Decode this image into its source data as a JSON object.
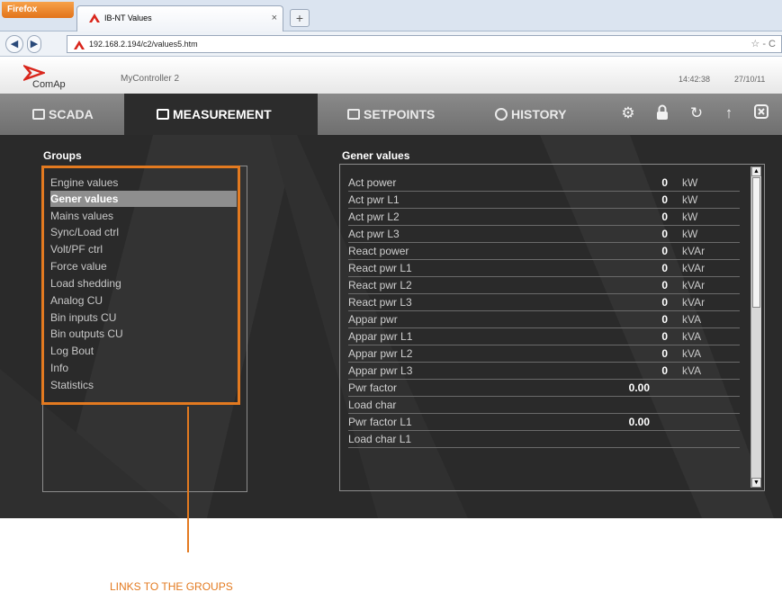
{
  "browser": {
    "menu_button": "Firefox",
    "tab_title": "IB-NT Values",
    "tab_close": "×",
    "new_tab": "+",
    "url": "192.168.2.194/c2/values5.htm",
    "url_tools": "☆ - C"
  },
  "app": {
    "brand": "ComAp",
    "controller_name": "MyController 2",
    "time": "14:42:38",
    "date": "27/10/11"
  },
  "menu": {
    "scada": "SCADA",
    "measurement": "MEASUREMENT",
    "setpoints": "SETPOINTS",
    "history": "HISTORY"
  },
  "groups": {
    "title": "Groups",
    "items": [
      "Engine values",
      "Gener values",
      "Mains values",
      "Sync/Load ctrl",
      "Volt/PF ctrl",
      "Force value",
      "Load shedding",
      "Analog CU",
      "Bin inputs CU",
      "Bin outputs CU",
      "Log Bout",
      "Info",
      "Statistics"
    ],
    "selected": "Gener values"
  },
  "values": {
    "title": "Gener values",
    "rows": [
      {
        "name": "Act power",
        "value": "0",
        "unit": "kW"
      },
      {
        "name": "Act pwr L1",
        "value": "0",
        "unit": "kW"
      },
      {
        "name": "Act pwr L2",
        "value": "0",
        "unit": "kW"
      },
      {
        "name": "Act pwr L3",
        "value": "0",
        "unit": "kW"
      },
      {
        "name": "React power",
        "value": "0",
        "unit": "kVAr"
      },
      {
        "name": "React pwr L1",
        "value": "0",
        "unit": "kVAr"
      },
      {
        "name": "React pwr L2",
        "value": "0",
        "unit": "kVAr"
      },
      {
        "name": "React pwr L3",
        "value": "0",
        "unit": "kVAr"
      },
      {
        "name": "Appar pwr",
        "value": "0",
        "unit": "kVA"
      },
      {
        "name": "Appar pwr L1",
        "value": "0",
        "unit": "kVA"
      },
      {
        "name": "Appar pwr L2",
        "value": "0",
        "unit": "kVA"
      },
      {
        "name": "Appar pwr L3",
        "value": "0",
        "unit": "kVA"
      },
      {
        "name": "Pwr factor",
        "value": "0.00",
        "unit": ""
      },
      {
        "name": "Load char",
        "value": "",
        "unit": ""
      },
      {
        "name": "Pwr factor L1",
        "value": "0.00",
        "unit": ""
      },
      {
        "name": "Load char L1",
        "value": "",
        "unit": ""
      }
    ]
  },
  "callout": "LINKS TO THE GROUPS",
  "colors": {
    "accent_orange": "#e37a20",
    "panel_dark": "#2a2a2a",
    "menu_gray": "#7b7b7b"
  }
}
